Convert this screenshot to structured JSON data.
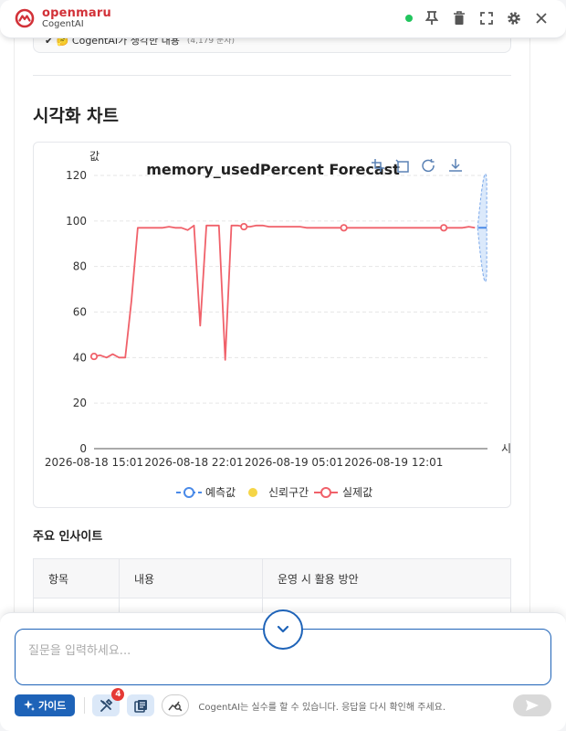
{
  "header": {
    "brand_name": "openmaru",
    "product_name": "CogentAI",
    "status_color": "#22c55e",
    "icons": [
      "pin-icon",
      "trash-icon",
      "fullscreen-icon",
      "settings-icon",
      "close-icon"
    ]
  },
  "previous": {
    "row_text": "✔ 🤔 CogentAI가 생각한 내용",
    "row_meta": "(4,179 문자)"
  },
  "section_title": "시각화 차트",
  "chart_toolbar_icons": [
    "zoom-icon",
    "zoom-reset-icon",
    "refresh-icon",
    "download-icon"
  ],
  "chart_data": {
    "type": "line",
    "title": "memory_usedPercent Forecast",
    "ylabel": "값",
    "xlabel": "시",
    "ylim": [
      0,
      120
    ],
    "yticks": [
      "0",
      "20",
      "40",
      "60",
      "80",
      "100",
      "120"
    ],
    "xticks": [
      "2026-08-18 15:01",
      "2026-08-18 22:01",
      "2026-08-19 05:01",
      "2026-08-19 12:01"
    ],
    "legend": [
      "예측값",
      "신뢰구간",
      "실제값"
    ],
    "legend_position": "bottom",
    "grid": true,
    "colors": {
      "actual": "#f0616a",
      "forecast": "#4a8ae8",
      "confidence": "#f5d547"
    },
    "series": [
      {
        "name": "실제값",
        "x": [
          0,
          1,
          2,
          3,
          4,
          5,
          6,
          7,
          8,
          9,
          10,
          11,
          12,
          13,
          14,
          15,
          16,
          17,
          18,
          19,
          20,
          21,
          22,
          23,
          24,
          25,
          26,
          27,
          28,
          29,
          30,
          31,
          32,
          33,
          34,
          35,
          36,
          37,
          38,
          39,
          40,
          41,
          42,
          43,
          44,
          45,
          46,
          47,
          48,
          49,
          50,
          51,
          52,
          53,
          54,
          55,
          56,
          57,
          58,
          59,
          60,
          61
        ],
        "y": [
          40.5,
          41,
          40,
          41.5,
          40,
          40,
          65,
          97,
          97,
          97,
          97,
          97,
          97.5,
          97,
          97,
          96,
          98,
          54,
          98,
          98,
          98,
          39,
          98,
          98,
          97.5,
          97.5,
          98,
          98,
          97.5,
          97.5,
          97.5,
          97.5,
          97.5,
          97.5,
          97,
          97,
          97,
          97,
          97,
          97,
          97,
          97,
          97,
          97,
          97,
          97,
          97,
          97,
          97,
          97,
          97,
          97,
          97,
          97,
          97,
          97,
          97,
          97,
          97,
          97,
          97.5,
          97
        ]
      }
    ],
    "x_index_range": [
      0,
      63
    ],
    "forecast_start_index": 62
  },
  "insights": {
    "title": "주요 인사이트",
    "columns": [
      "항목",
      "내용",
      "운영 시 활용 방안"
    ]
  },
  "input": {
    "placeholder": "질문을 입력하세요..."
  },
  "toolbar": {
    "guide_label": "가이드",
    "tools_badge": "4",
    "disclaimer": "CogentAI는 실수를 할 수 있습니다. 응답을 다시 확인해 주세요."
  }
}
